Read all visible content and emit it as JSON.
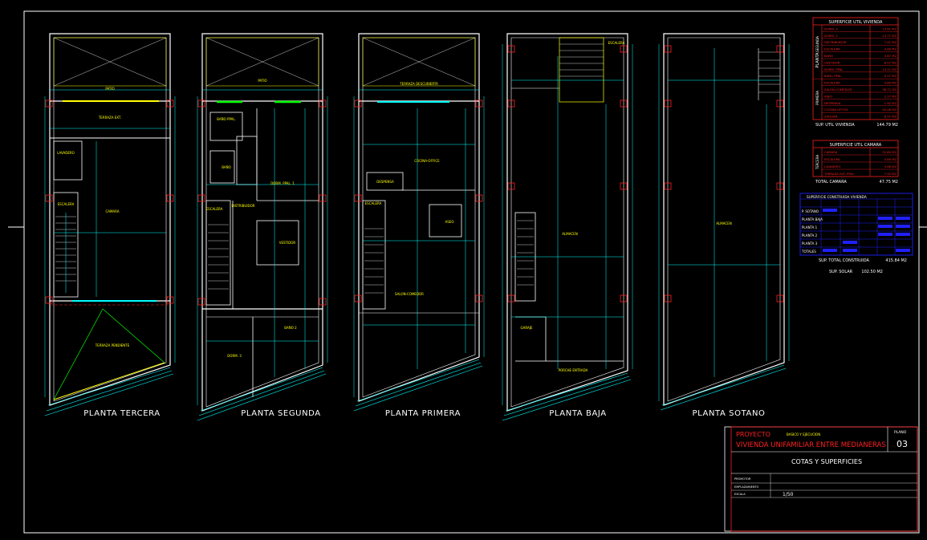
{
  "plans": [
    {
      "label": "PLANTA TERCERA",
      "rooms": [
        "PATIO",
        "TERRAZA EXT.",
        "LAVADERO",
        "ESCALERA",
        "CAMARA",
        "TERRAZA PENDIENTE"
      ]
    },
    {
      "label": "PLANTA SEGUNDA",
      "rooms": [
        "PATIO",
        "BAÑO PPAL.",
        "BAÑO",
        "DORM. PPAL. 1",
        "ESCALERA",
        "DISTRIBUIDOR",
        "VESTIDOR",
        "BAÑO 2",
        "DORM. 3"
      ]
    },
    {
      "label": "PLANTA PRIMERA",
      "rooms": [
        "TERRAZA DESCUBIERTA",
        "COCINA-OFFICE",
        "DESPENSA",
        "ESCALERA",
        "ASEO",
        "SALON-COMEDOR"
      ]
    },
    {
      "label": "PLANTA BAJA",
      "rooms": [
        "ESCALERA",
        "ALMACEN",
        "GARAJE",
        "PORCHE ENTRADA"
      ]
    },
    {
      "label": "PLANTA SOTANO",
      "rooms": [
        "ALMACEN"
      ]
    }
  ],
  "table_util_vivienda": {
    "title": "SUPERFICIE UTIL VIVIENDA",
    "group_labels": [
      "PLANTA",
      "SEGUNDA",
      "PRIMERA"
    ],
    "rows": [
      {
        "name": "DORM. 3",
        "value": "13.61 M2"
      },
      {
        "name": "DORM. 2",
        "value": "13.77 M2"
      },
      {
        "name": "DISTRIBUIDOR",
        "value": "7.41 M2"
      },
      {
        "name": "ESCALERA",
        "value": "4.89 M2"
      },
      {
        "name": "BAÑO",
        "value": "3.87 M2"
      },
      {
        "name": "VESTIDOR",
        "value": "6.57 M2"
      },
      {
        "name": "DORM. PPAL.",
        "value": "14.21 M2"
      },
      {
        "name": "BAÑO PPAL.",
        "value": "5.57 M2"
      },
      {
        "name": "ESCALERA",
        "value": "4.89 M2"
      },
      {
        "name": "SALON-COMEDOR",
        "value": "38.72 M2"
      },
      {
        "name": "ASEO",
        "value": "2.27 M2"
      },
      {
        "name": "DESPENSA",
        "value": "1.92 M2"
      },
      {
        "name": "COCINA-OFFICE",
        "value": "20.46 M2"
      },
      {
        "name": "ZAGUAN",
        "value": "6.57 M2"
      }
    ],
    "total_label": "SUP. UTIL VIVIENDA",
    "total_value": "144.79 M2"
  },
  "table_util_camara": {
    "title": "SUPERFICIE UTIL CAMARA",
    "group_label": "TERCERA",
    "rows": [
      {
        "name": "CAMARA",
        "value": "32.80 M2"
      },
      {
        "name": "ESCALERA",
        "value": "3.89 M2"
      },
      {
        "name": "LAVADERO",
        "value": "3.66 M2"
      },
      {
        "name": "TERRAZA EXT. PRIV.",
        "value": "7.45 M2"
      }
    ],
    "total_label": "TOTAL CAMARA",
    "total_value": "47.75 M2"
  },
  "table_construida": {
    "title": "SUPERFICIE CONSTRUIDA VIVIENDA",
    "rows": [
      "P. SOTANO",
      "PLANTA BAJA",
      "PLANTA 1",
      "PLANTA 2",
      "PLANTA 3",
      "TOTALES"
    ],
    "total_label": "SUP. TOTAL CONSTRUIDA",
    "total_value": "415.84 M2",
    "solar_label": "SUP. SOLAR",
    "solar_value": "102.50 M2"
  },
  "title_block": {
    "proyecto_label": "PROYECTO",
    "proyecto_sub": "BASICO Y EJECUCION",
    "proyecto_name": "VIVIENDA UNIFAMILIAR ENTRE MEDIANERAS",
    "plano_label": "PLANO",
    "plano_number": "03",
    "sheet_title": "COTAS Y SUPERFICIES",
    "field1": "PROMOTOR",
    "field2": "EMPLAZAMIENTO",
    "escala_label": "ESCALA",
    "escala_value": "1/50"
  },
  "colors": {
    "cyan": "#00ffff",
    "white": "#ffffff",
    "yellow": "#ffff00",
    "red": "#ff2020",
    "green": "#00ff00",
    "blue": "#2020ff"
  }
}
